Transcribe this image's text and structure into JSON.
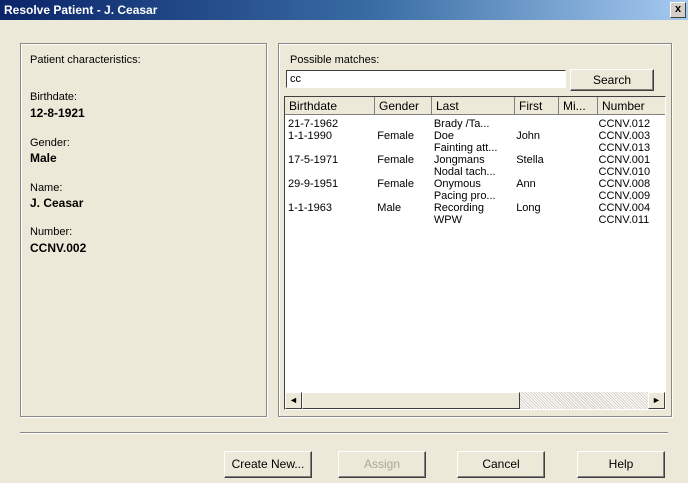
{
  "window": {
    "title": "Resolve Patient - J. Ceasar",
    "close_label": "x"
  },
  "patient": {
    "section_title": "Patient characteristics:",
    "birthdate_label": "Birthdate:",
    "birthdate_value": "12-8-1921",
    "gender_label": "Gender:",
    "gender_value": "Male",
    "name_label": "Name:",
    "name_value": "J. Ceasar",
    "number_label": "Number:",
    "number_value": "CCNV.002"
  },
  "matches": {
    "label": "Possible matches:",
    "search_value": "cc",
    "search_button": "Search",
    "columns": [
      "Birthdate",
      "Gender",
      "Last",
      "First",
      "Mi...",
      "Number"
    ],
    "rows": [
      [
        "21-7-1962",
        "",
        "Brady /Ta...",
        "",
        "",
        "CCNV.012"
      ],
      [
        "1-1-1990",
        "Female",
        "Doe",
        "John",
        "",
        "CCNV.003"
      ],
      [
        "",
        "",
        "Fainting att...",
        "",
        "",
        "CCNV.013"
      ],
      [
        "17-5-1971",
        "Female",
        "Jongmans",
        "Stella",
        "",
        "CCNV.001"
      ],
      [
        "",
        "",
        "Nodal tach...",
        "",
        "",
        "CCNV.010"
      ],
      [
        "29-9-1951",
        "Female",
        "Onymous",
        "Ann",
        "",
        "CCNV.008"
      ],
      [
        "",
        "",
        "Pacing pro...",
        "",
        "",
        "CCNV.009"
      ],
      [
        "1-1-1963",
        "Male",
        "Recording",
        "Long",
        "",
        "CCNV.004"
      ],
      [
        "",
        "",
        "WPW",
        "",
        "",
        "CCNV.011"
      ]
    ]
  },
  "buttons": {
    "create_new": "Create New...",
    "assign": "Assign",
    "cancel": "Cancel",
    "help": "Help"
  },
  "scrollbar": {
    "left_arrow": "◄",
    "right_arrow": "►"
  }
}
